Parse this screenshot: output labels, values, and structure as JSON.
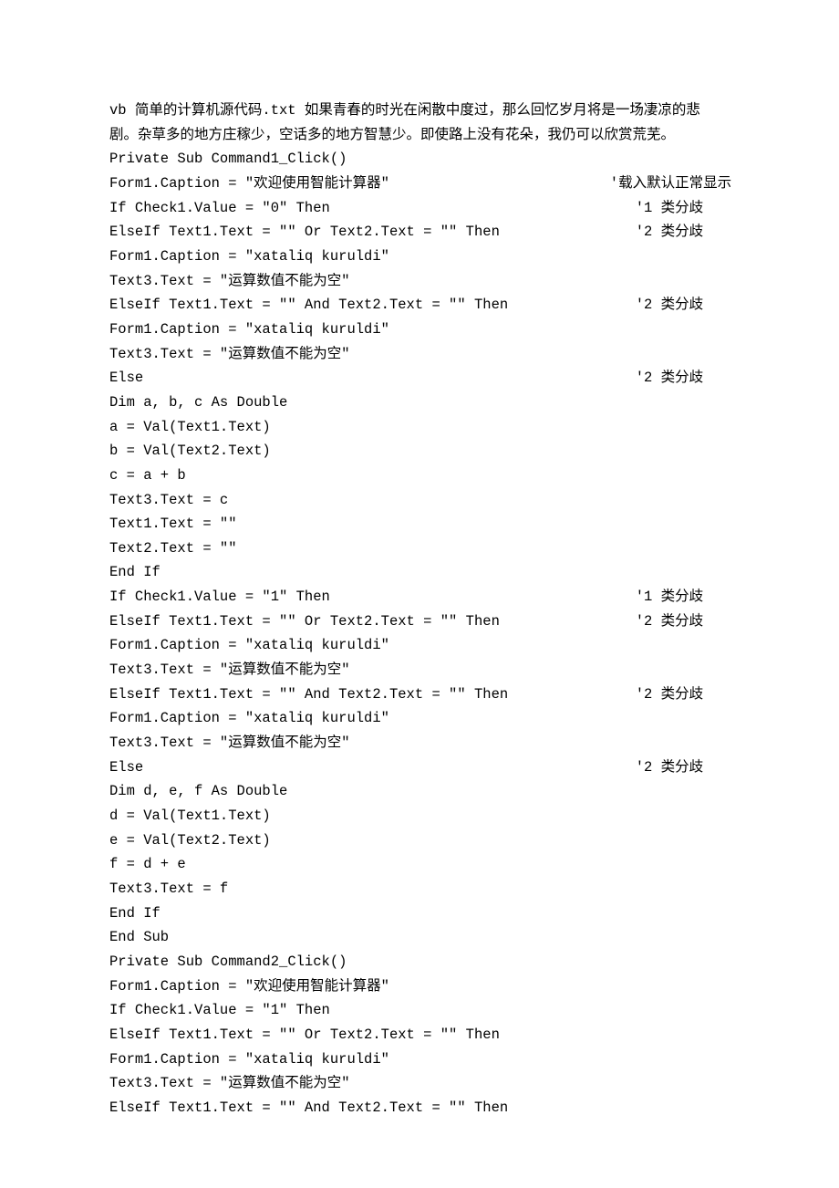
{
  "lines": [
    "vb 简单的计算机源代码.txt 如果青春的时光在闲散中度过，那么回忆岁月将是一场凄凉的悲",
    "剧。杂草多的地方庄稼少，空话多的地方智慧少。即使路上没有花朵，我仍可以欣赏荒芜。",
    "Private Sub Command1_Click()",
    "Form1.Caption = \"欢迎使用智能计算器\"                          '载入默认正常显示",
    "If Check1.Value = \"0\" Then                                    '1 类分歧",
    "ElseIf Text1.Text = \"\" Or Text2.Text = \"\" Then                '2 类分歧",
    "Form1.Caption = \"xataliq kuruldi\"",
    "Text3.Text = \"运算数值不能为空\"",
    "ElseIf Text1.Text = \"\" And Text2.Text = \"\" Then               '2 类分歧",
    "Form1.Caption = \"xataliq kuruldi\"",
    "Text3.Text = \"运算数值不能为空\"",
    "Else                                                          '2 类分歧",
    "Dim a, b, c As Double",
    "a = Val(Text1.Text)",
    "b = Val(Text2.Text)",
    "c = a + b",
    "Text3.Text = c",
    "Text1.Text = \"\"",
    "Text2.Text = \"\"",
    "End If",
    "",
    "If Check1.Value = \"1\" Then                                    '1 类分歧",
    "ElseIf Text1.Text = \"\" Or Text2.Text = \"\" Then                '2 类分歧",
    "Form1.Caption = \"xataliq kuruldi\"",
    "Text3.Text = \"运算数值不能为空\"",
    "ElseIf Text1.Text = \"\" And Text2.Text = \"\" Then               '2 类分歧",
    "Form1.Caption = \"xataliq kuruldi\"",
    "Text3.Text = \"运算数值不能为空\"",
    "Else                                                          '2 类分歧",
    "Dim d, e, f As Double",
    "d = Val(Text1.Text)",
    "e = Val(Text2.Text)",
    "f = d + e",
    "Text3.Text = f",
    "End If",
    "End Sub",
    "",
    "Private Sub Command2_Click()",
    "Form1.Caption = \"欢迎使用智能计算器\"",
    "If Check1.Value = \"1\" Then",
    "ElseIf Text1.Text = \"\" Or Text2.Text = \"\" Then",
    "Form1.Caption = \"xataliq kuruldi\"",
    "Text3.Text = \"运算数值不能为空\"",
    "ElseIf Text1.Text = \"\" And Text2.Text = \"\" Then"
  ]
}
